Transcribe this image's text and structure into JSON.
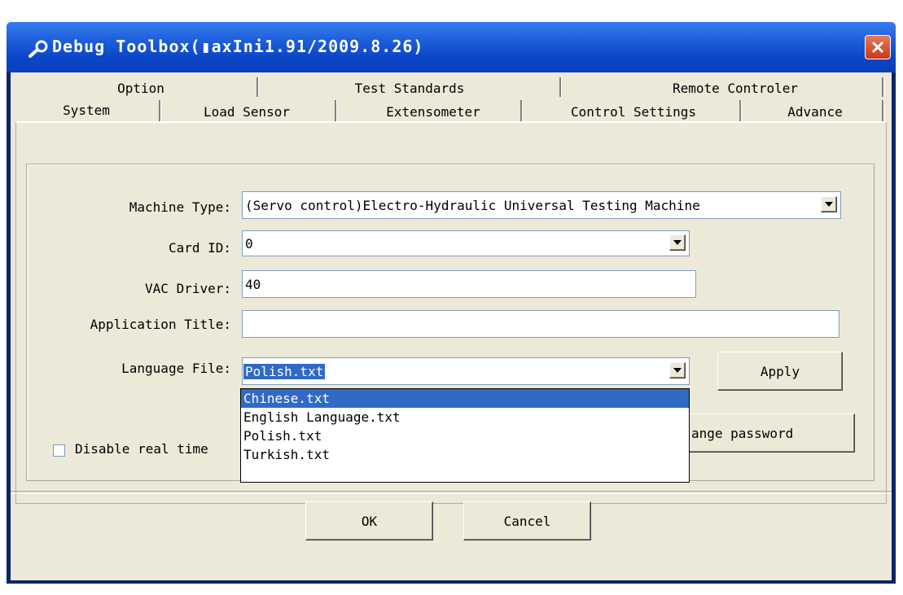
{
  "window": {
    "title": "Debug Toolbox(▮axIni1.91/2009.8.26)"
  },
  "tabs": {
    "row1": [
      "Option",
      "Test Standards",
      "Remote Controler"
    ],
    "row2": [
      "System",
      "Load Sensor",
      "Extensometer",
      "Control Settings",
      "Advance"
    ],
    "active": "System"
  },
  "form": {
    "machine_type_label": "Machine Type:",
    "machine_type_value": "(Servo control)Electro-Hydraulic Universal Testing Machine",
    "card_id_label": "Card ID:",
    "card_id_value": "0",
    "vac_driver_label": "VAC Driver:",
    "vac_driver_value": "40",
    "app_title_label": "Application Title:",
    "app_title_value": "",
    "language_file_label": "Language File:",
    "language_file_value": "Polish.txt",
    "apply_label": "Apply",
    "change_password_label": "ange password",
    "disable_label": "Disable real time"
  },
  "language_options": [
    "Chinese.txt",
    "English Language.txt",
    "Polish.txt",
    "Turkish.txt"
  ],
  "language_highlighted_index": 0,
  "footer": {
    "ok_label": "OK",
    "cancel_label": "Cancel"
  },
  "colors": {
    "titlebar": "#0a47c8",
    "dialog_bg": "#ece9d8",
    "selection": "#316ac5",
    "close": "#c9391a"
  },
  "icons": {
    "title": "wrench-icon",
    "close": "close-icon",
    "dropdown": "chevron-down-icon"
  }
}
